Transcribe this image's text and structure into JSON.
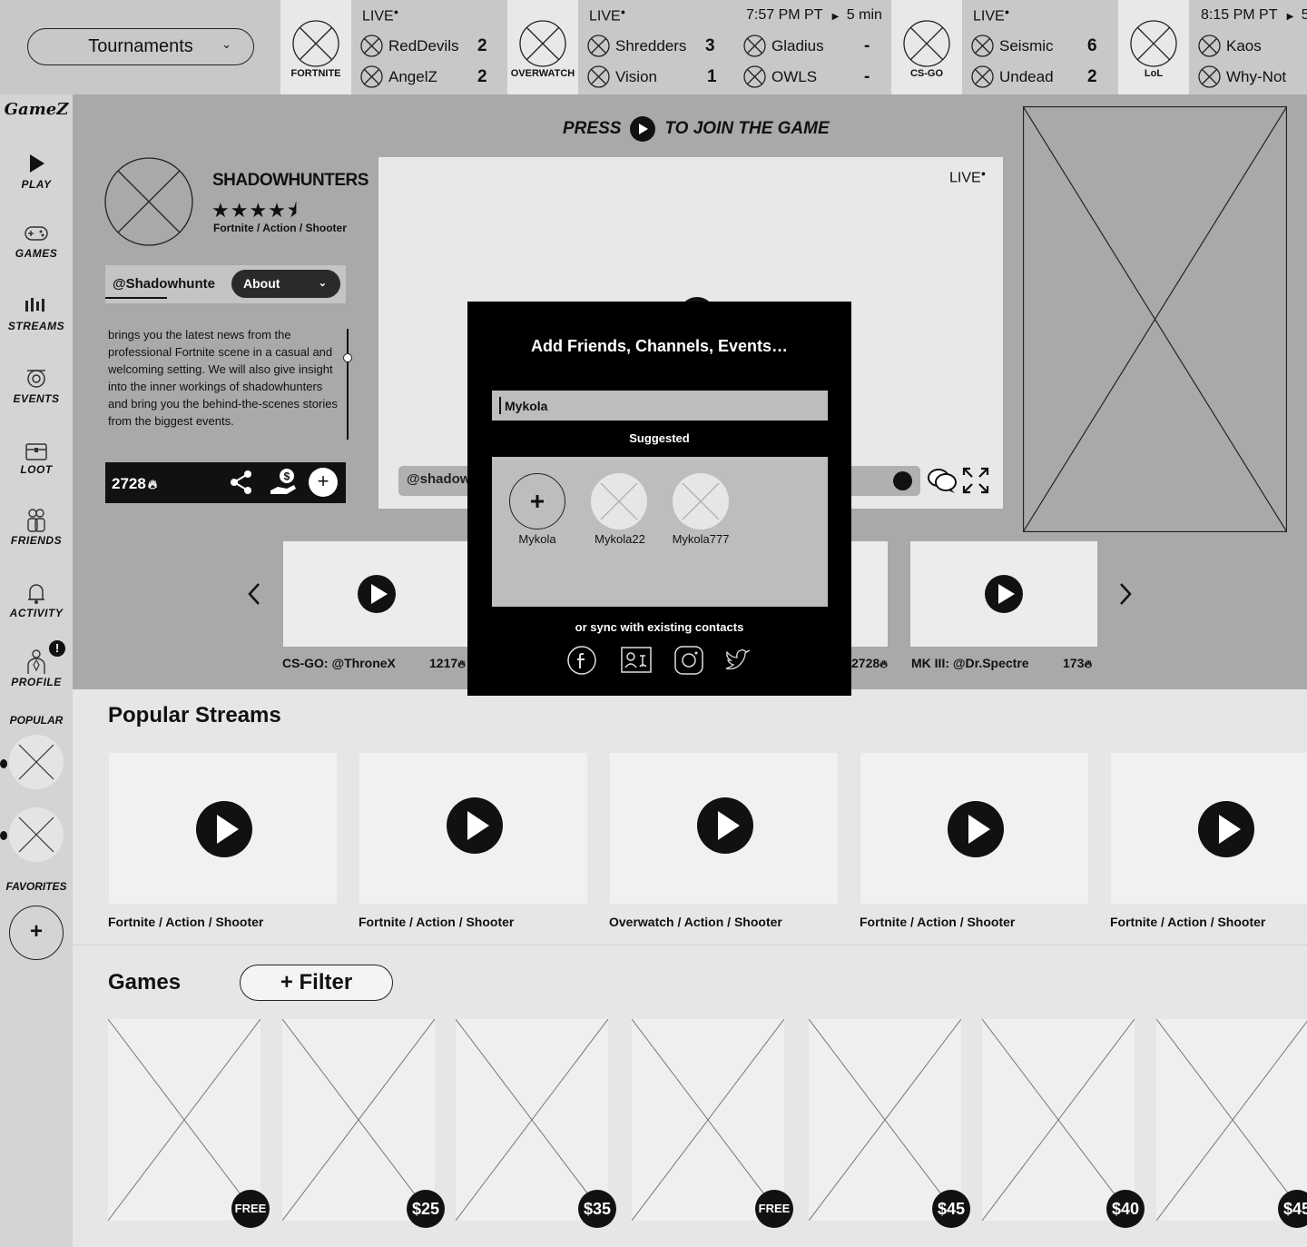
{
  "topbar": {
    "tournaments_label": "Tournaments",
    "games": [
      {
        "name": "FORTNITE"
      },
      {
        "name": "OVERWATCH"
      },
      {
        "name": "CS-GO"
      },
      {
        "name": "LoL"
      }
    ],
    "matches": [
      {
        "status": "LIVE",
        "teams": [
          {
            "name": "RedDevils",
            "score": "2"
          },
          {
            "name": "AngelZ",
            "score": "2"
          }
        ]
      },
      {
        "status": "LIVE",
        "teams": [
          {
            "name": "Shredders",
            "score": "3"
          },
          {
            "name": "Vision",
            "score": "1"
          }
        ]
      },
      {
        "time": "7:57 PM PT",
        "countdown": "5 min",
        "teams": [
          {
            "name": "Gladius",
            "score": "-"
          },
          {
            "name": "OWLS",
            "score": "-"
          }
        ]
      },
      {
        "status": "LIVE",
        "teams": [
          {
            "name": "Seismic",
            "score": "6"
          },
          {
            "name": "Undead",
            "score": "2"
          }
        ]
      },
      {
        "time": "8:15 PM PT",
        "countdown": "5",
        "teams": [
          {
            "name": "Kaos"
          },
          {
            "name": "Why-Not"
          }
        ]
      }
    ]
  },
  "sidebar": {
    "logo": "GameZ",
    "items": [
      {
        "label": "Play",
        "icon": "play-icon"
      },
      {
        "label": "Games",
        "icon": "gamepad-icon"
      },
      {
        "label": "Streams",
        "icon": "streams-icon"
      },
      {
        "label": "Events",
        "icon": "events-icon"
      },
      {
        "label": "Loot",
        "icon": "chest-icon"
      },
      {
        "label": "Friends",
        "icon": "friends-icon"
      },
      {
        "label": "Activity",
        "icon": "bell-icon"
      },
      {
        "label": "Profile",
        "icon": "profile-icon",
        "badge": "!"
      }
    ],
    "popular_label": "Popular",
    "favorites_label": "Favorites",
    "add_favorite": "+"
  },
  "hero": {
    "press_before": "Press",
    "press_after": "to Join the Game",
    "channel": {
      "name": "SHADOWHUNTERS",
      "rating": 4.5,
      "stars": "★★★★⯨",
      "genre": "Fortnite / Action / Shooter",
      "handle": "@Shadowhunte",
      "about_label": "About",
      "about_text": "brings you the latest news from the professional Fortnite scene in a casual and welcoming setting. We will also give insight into the inner workings of shadowhunters and bring you the behind-the-scenes stories from the biggest events.",
      "fire_count": "2728"
    },
    "video": {
      "live_label": "LIVE",
      "chat_handle": "@shadowh"
    }
  },
  "carousel": [
    {
      "caption": "CS-GO: @ThroneX",
      "count": "1217"
    },
    {
      "caption": "",
      "count": "2728"
    },
    {
      "caption": "MK III: @Dr.Spectre",
      "count": "173"
    }
  ],
  "modal": {
    "title": "Add Friends, Channels, Events…",
    "search_value": "Mykola",
    "suggested_label": "Suggested",
    "suggestions": [
      {
        "name": "Mykola"
      },
      {
        "name": "Mykola22"
      },
      {
        "name": "Mykola777"
      }
    ],
    "sync_label": "or sync with existing contacts",
    "socials": [
      "facebook-icon",
      "contacts-icon",
      "instagram-icon",
      "twitter-icon"
    ]
  },
  "popular_streams": {
    "title": "Popular Streams",
    "items": [
      {
        "caption": "Fortnite / Action / Shooter"
      },
      {
        "caption": "Fortnite / Action / Shooter"
      },
      {
        "caption": "Overwatch / Action / Shooter"
      },
      {
        "caption": "Fortnite / Action / Shooter"
      },
      {
        "caption": "Fortnite / Action / Shooter"
      }
    ]
  },
  "games": {
    "title": "Games",
    "filter_label": "+ Filter",
    "prices": [
      "FREE",
      "$25",
      "$35",
      "FREE",
      "$45",
      "$40",
      "$45"
    ]
  }
}
